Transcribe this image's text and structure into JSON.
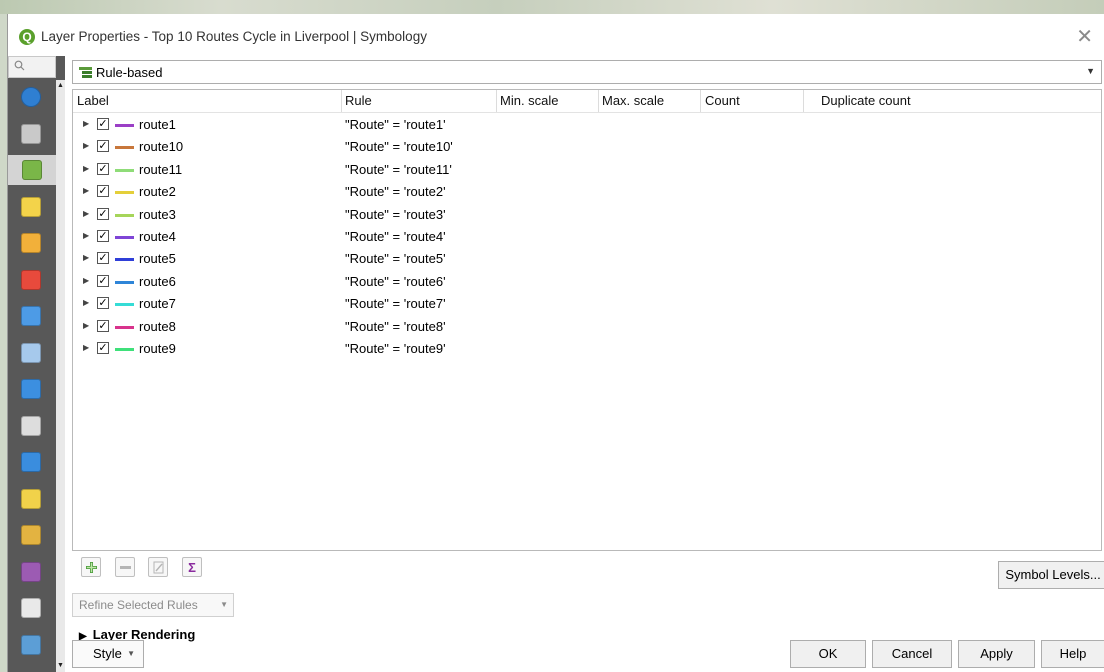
{
  "window": {
    "title": "Layer Properties - Top 10 Routes Cycle in Liverpool | Symbology",
    "app_icon": "qgis-icon"
  },
  "sidebar": {
    "search_icon": "search-icon",
    "items": [
      {
        "name": "information-icon",
        "color": "#2f7fd2"
      },
      {
        "name": "source-icon",
        "color": "#c9c9c9"
      },
      {
        "name": "symbology-icon",
        "color": "#7ab648"
      },
      {
        "name": "labels-icon",
        "color": "#f3d34a"
      },
      {
        "name": "masks-icon",
        "color": "#f2b03a"
      },
      {
        "name": "3d-view-icon",
        "color": "#e84a3c"
      },
      {
        "name": "fields-icon",
        "color": "#4d9be6"
      },
      {
        "name": "attributes-form-icon",
        "color": "#a6c9ec"
      },
      {
        "name": "joins-icon",
        "color": "#3c8fe0"
      },
      {
        "name": "auxiliary-storage-icon",
        "color": "#dddddd"
      },
      {
        "name": "actions-icon",
        "color": "#3a8dde"
      },
      {
        "name": "display-icon",
        "color": "#f1d24a"
      },
      {
        "name": "rendering-icon",
        "color": "#e3b341"
      },
      {
        "name": "variables-icon",
        "color": "#9c5bb3"
      },
      {
        "name": "metadata-icon",
        "color": "#e9e9e9"
      },
      {
        "name": "dependencies-icon",
        "color": "#5c9ed6"
      }
    ]
  },
  "renderer": {
    "label": "Rule-based"
  },
  "tree": {
    "headers": [
      "Label",
      "Rule",
      "Min. scale",
      "Max. scale",
      "Count",
      "Duplicate count"
    ],
    "rows": [
      {
        "label": "route1",
        "rule": "\"Route\" = 'route1'",
        "color": "#9b3fc6",
        "checked": "✓"
      },
      {
        "label": "route10",
        "rule": "\"Route\" = 'route10'",
        "color": "#c8773b",
        "checked": "✓"
      },
      {
        "label": "route11",
        "rule": "\"Route\" = 'route11'",
        "color": "#8fdc78",
        "checked": "✓"
      },
      {
        "label": "route2",
        "rule": "\"Route\" = 'route2'",
        "color": "#e4cf3a",
        "checked": "✓"
      },
      {
        "label": "route3",
        "rule": "\"Route\" = 'route3'",
        "color": "#a6d55a",
        "checked": "✓"
      },
      {
        "label": "route4",
        "rule": "\"Route\" = 'route4'",
        "color": "#7f45d6",
        "checked": "✓"
      },
      {
        "label": "route5",
        "rule": "\"Route\" = 'route5'",
        "color": "#2f3fd8",
        "checked": "✓"
      },
      {
        "label": "route6",
        "rule": "\"Route\" = 'route6'",
        "color": "#2e85d8",
        "checked": "✓"
      },
      {
        "label": "route7",
        "rule": "\"Route\" = 'route7'",
        "color": "#35dcd6",
        "checked": "✓"
      },
      {
        "label": "route8",
        "rule": "\"Route\" = 'route8'",
        "color": "#d8338c",
        "checked": "✓"
      },
      {
        "label": "route9",
        "rule": "\"Route\" = 'route9'",
        "color": "#3fe07a",
        "checked": "✓"
      }
    ]
  },
  "toolbar": {
    "add_icon": "add-rule-icon",
    "remove_icon": "remove-rule-icon",
    "edit_icon": "edit-rule-icon",
    "sigma": "Σ",
    "symbol_levels": "Symbol Levels..."
  },
  "refine": {
    "label": "Refine Selected Rules"
  },
  "layer_rendering": {
    "label": "Layer Rendering"
  },
  "buttons": {
    "style": "Style",
    "ok": "OK",
    "cancel": "Cancel",
    "apply": "Apply",
    "help": "Help"
  }
}
